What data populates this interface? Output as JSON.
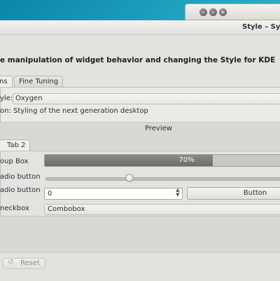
{
  "background_window": {
    "buttons": [
      "–",
      "–",
      "×"
    ]
  },
  "window": {
    "title": "Style – Sy"
  },
  "description": "e manipulation of widget behavior and changing the Style for KDE",
  "tabs": [
    {
      "label": "ns",
      "active": true
    },
    {
      "label": "Fine Tuning",
      "active": false
    }
  ],
  "style_row": {
    "label": "yle:",
    "value": "Oxygen"
  },
  "description_row": {
    "text": "on: Styling of the next generation desktop"
  },
  "preview": {
    "label": "Preview",
    "inner_tab": "Tab 2",
    "group_box_label": "oup Box",
    "radio_button_1": "adio button",
    "radio_button_2": "adio button",
    "checkbox_label": "neckbox",
    "progress": {
      "text": "70%",
      "value": 0.7
    },
    "slider": {
      "value": 0.35
    },
    "spinbox_value": "0",
    "push_button_label": "Button",
    "combobox_value": "Combobox"
  },
  "footer": {
    "reset_label": "Reset"
  },
  "colors": {
    "desktop": "#23a6c4",
    "window_bg": "#e3e2de",
    "progress_fill": "#7a7976"
  }
}
